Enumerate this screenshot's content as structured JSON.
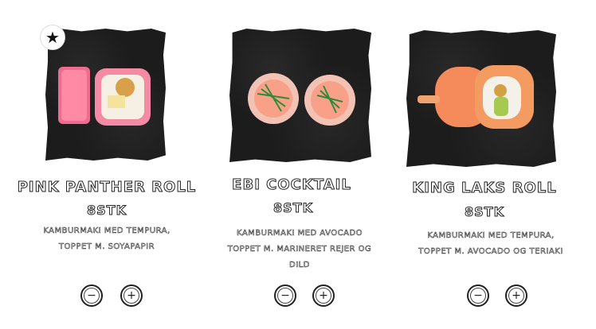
{
  "favorite_icon": "star-icon",
  "products": [
    {
      "name": "PINK PANTHER ROLL",
      "qty": "8STK",
      "desc": [
        "KAMBURMAKI MED TEMPURA,",
        "TOPPET M. SOYAPAPIR"
      ],
      "remove_icon": "minus-icon",
      "add_icon": "plus-icon"
    },
    {
      "name": "EBI COCKTAIL",
      "qty": "8STK",
      "desc": [
        "KAMBURMAKI MED AVOCADO",
        "TOPPET M. MARINERET REJER OG",
        "DILD"
      ],
      "remove_icon": "minus-icon",
      "add_icon": "plus-icon"
    },
    {
      "name": "KING LAKS ROLL",
      "qty": "8STK",
      "desc": [
        "KAMBURMAKI MED TEMPURA,",
        "TOPPET M. AVOCADO OG TERIAKI"
      ],
      "remove_icon": "minus-icon",
      "add_icon": "plus-icon"
    }
  ]
}
